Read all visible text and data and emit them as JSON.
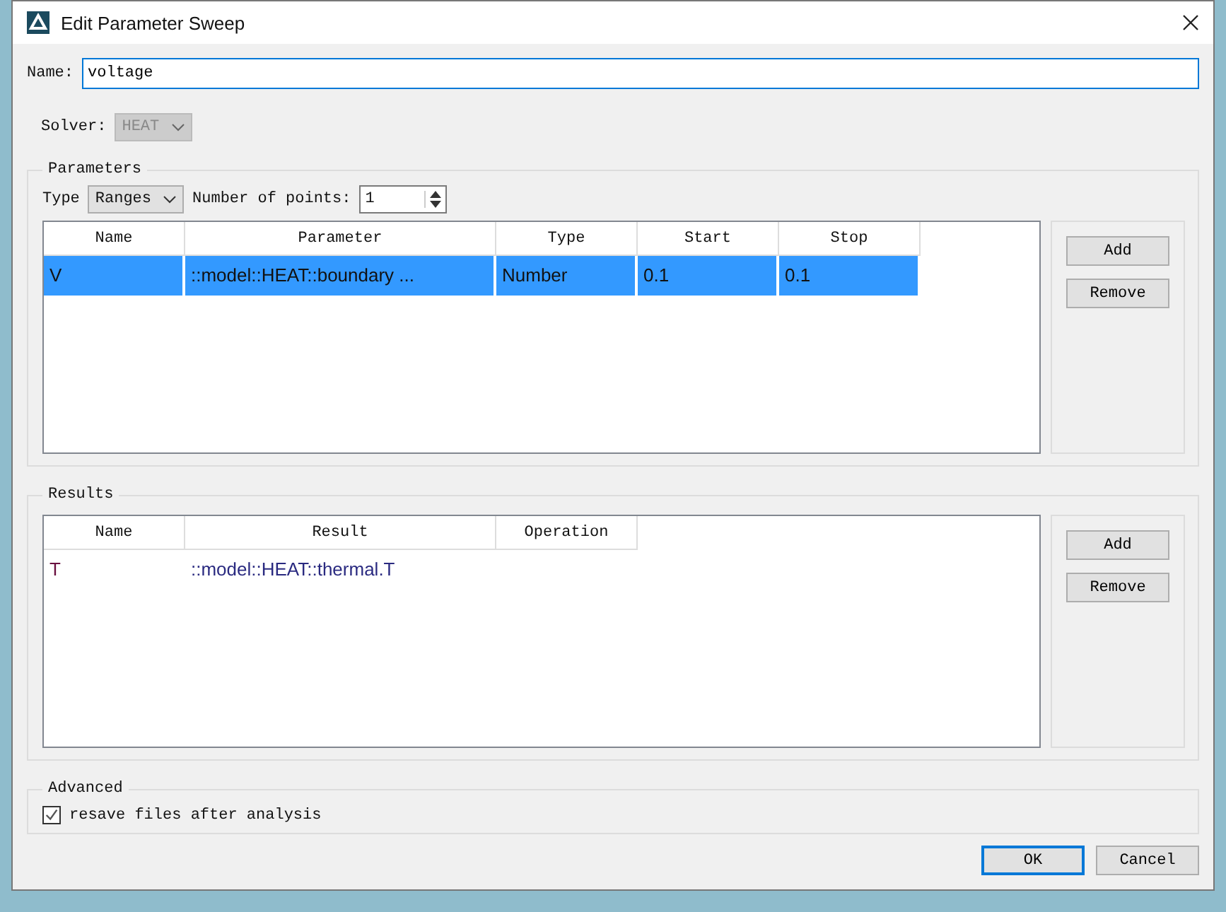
{
  "window": {
    "title": "Edit Parameter Sweep"
  },
  "name_field": {
    "label": "Name:",
    "value": "voltage"
  },
  "solver": {
    "label": "Solver:",
    "value": "HEAT",
    "disabled": true
  },
  "parameters": {
    "title": "Parameters",
    "type_label": "Type",
    "type_value": "Ranges",
    "points_label": "Number of points:",
    "points_value": "1",
    "columns": [
      "Name",
      "Parameter",
      "Type",
      "Start",
      "Stop"
    ],
    "rows": [
      {
        "cells": [
          "V",
          "::model::HEAT::boundary ...",
          "Number",
          "0.1",
          "0.1"
        ],
        "selected": true
      }
    ],
    "buttons": [
      "Add",
      "Remove"
    ]
  },
  "results": {
    "title": "Results",
    "columns": [
      "Name",
      "Result",
      "Operation"
    ],
    "rows": [
      {
        "cells": [
          "T",
          "::model::HEAT::thermal.T"
        ],
        "selected": false
      }
    ],
    "buttons": [
      "Add",
      "Remove"
    ]
  },
  "advanced": {
    "title": "Advanced",
    "checkbox": {
      "label": "resave files after analysis",
      "checked": true
    }
  },
  "buttons": [
    {
      "label": "OK",
      "default": true
    },
    {
      "label": "Cancel",
      "default": false
    }
  ]
}
